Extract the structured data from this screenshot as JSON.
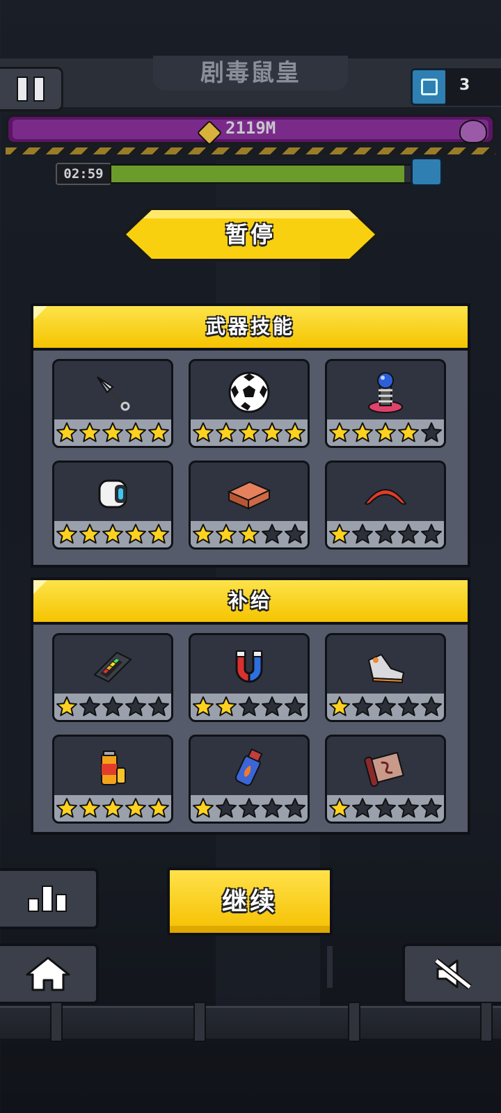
{
  "hud": {
    "boss_name": "剧毒鼠皇",
    "chest_count": "3",
    "distance": "2119M",
    "timer": "02:59",
    "wave_progress": 0.98
  },
  "pause": {
    "title": "暂停"
  },
  "weapon_panel": {
    "title": "武器技能",
    "slots": [
      {
        "icon": "kunai-icon",
        "stars": 5
      },
      {
        "icon": "soccer-ball-icon",
        "stars": 5
      },
      {
        "icon": "tesla-coil-icon",
        "stars": 4
      },
      {
        "icon": "drone-icon",
        "stars": 5
      },
      {
        "icon": "brick-icon",
        "stars": 3
      },
      {
        "icon": "boomerang-icon",
        "stars": 1
      }
    ]
  },
  "supply_panel": {
    "title": "补给",
    "slots": [
      {
        "icon": "battery-pack-icon",
        "stars": 1
      },
      {
        "icon": "magnet-icon",
        "stars": 2
      },
      {
        "icon": "sneaker-icon",
        "stars": 1
      },
      {
        "icon": "energy-drink-icon",
        "stars": 5
      },
      {
        "icon": "fire-bottle-icon",
        "stars": 1
      },
      {
        "icon": "scroll-icon",
        "stars": 1
      }
    ]
  },
  "buttons": {
    "continue": "继续",
    "stats_icon": "bar-chart-icon",
    "home_icon": "home-icon",
    "mute_icon": "mute-icon"
  },
  "colors": {
    "accent_yellow": "#f5c400",
    "star_filled": "#ffd21f",
    "star_empty": "#2b303b",
    "boss_bar": "#5b1466",
    "progress_green": "#6b9b2a"
  }
}
